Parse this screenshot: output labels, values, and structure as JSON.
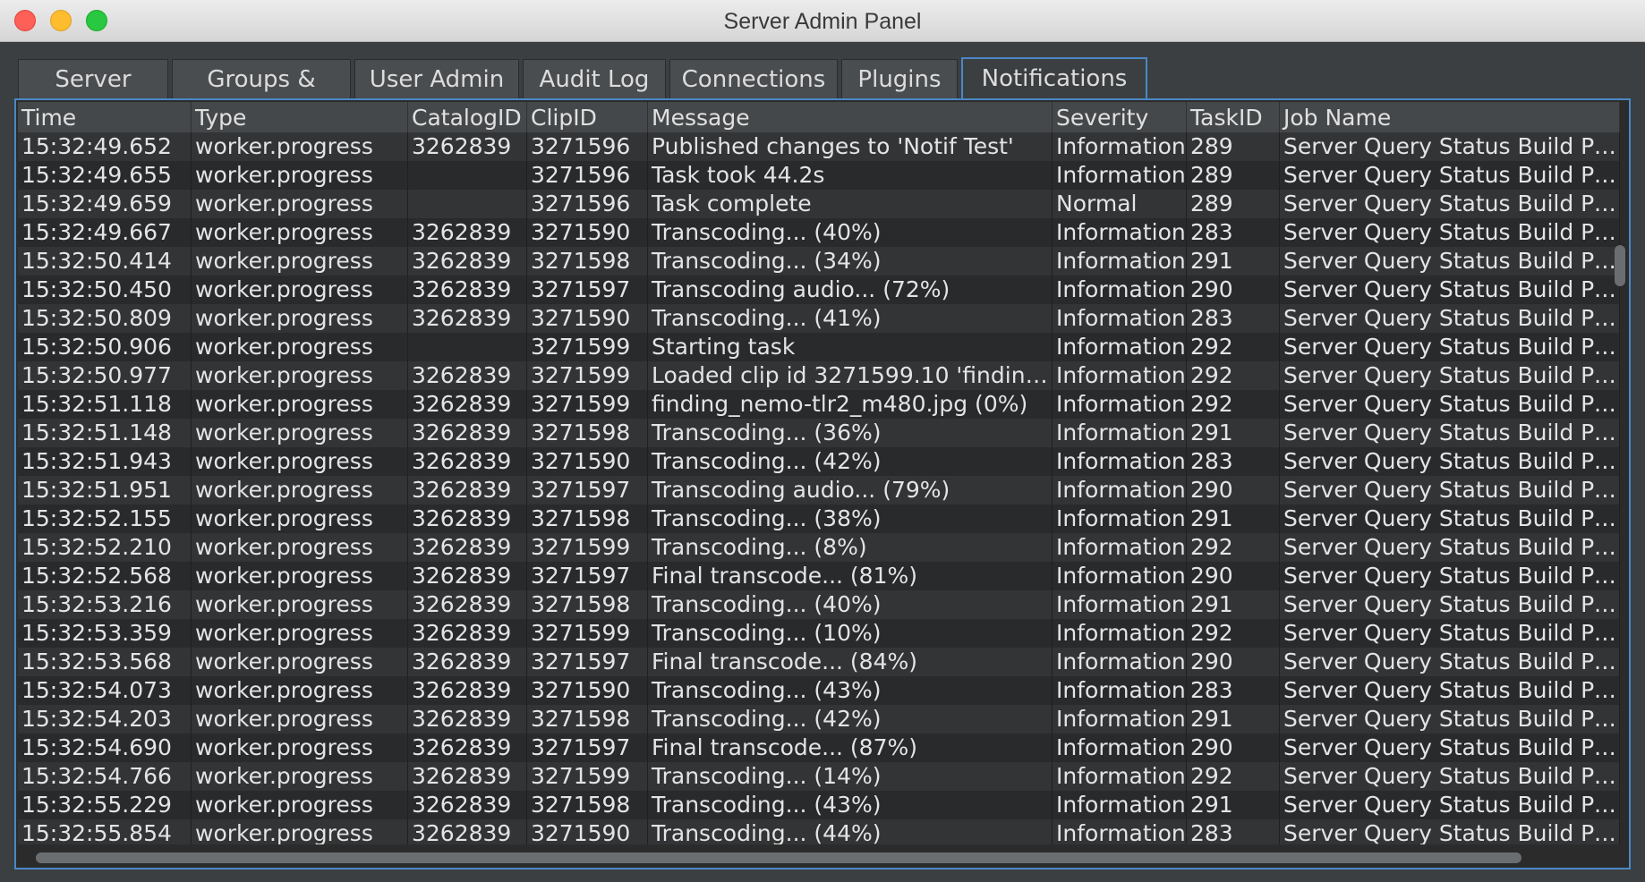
{
  "window": {
    "title": "Server Admin Panel"
  },
  "tabs": [
    {
      "label": "Server Status"
    },
    {
      "label": "Groups & Roles"
    },
    {
      "label": "User Admin"
    },
    {
      "label": "Audit Log"
    },
    {
      "label": "Connections"
    },
    {
      "label": "Plugins"
    },
    {
      "label": "Notifications"
    }
  ],
  "active_tab": "Notifications",
  "table": {
    "columns": [
      "Time",
      "Type",
      "CatalogID",
      "ClipID",
      "Message",
      "Severity",
      "TaskID",
      "Job Name"
    ],
    "rows": [
      [
        "15:32:49.652",
        "worker.progress",
        "3262839",
        "3271596",
        "Published changes to 'Notif Test'",
        "Information",
        "289",
        "Server Query Status Build Proxy"
      ],
      [
        "15:32:49.655",
        "worker.progress",
        "",
        "3271596",
        "Task took 44.2s",
        "Information",
        "289",
        "Server Query Status Build Proxy"
      ],
      [
        "15:32:49.659",
        "worker.progress",
        "",
        "3271596",
        "Task complete",
        "Normal",
        "289",
        "Server Query Status Build Proxy"
      ],
      [
        "15:32:49.667",
        "worker.progress",
        "3262839",
        "3271590",
        "Transcoding... (40%)",
        "Information",
        "283",
        "Server Query Status Build Proxy"
      ],
      [
        "15:32:50.414",
        "worker.progress",
        "3262839",
        "3271598",
        "Transcoding... (34%)",
        "Information",
        "291",
        "Server Query Status Build Proxy"
      ],
      [
        "15:32:50.450",
        "worker.progress",
        "3262839",
        "3271597",
        "Transcoding audio... (72%)",
        "Information",
        "290",
        "Server Query Status Build Proxy"
      ],
      [
        "15:32:50.809",
        "worker.progress",
        "3262839",
        "3271590",
        "Transcoding... (41%)",
        "Information",
        "283",
        "Server Query Status Build Proxy"
      ],
      [
        "15:32:50.906",
        "worker.progress",
        "",
        "3271599",
        "Starting task",
        "Information",
        "292",
        "Server Query Status Build Proxy"
      ],
      [
        "15:32:50.977",
        "worker.progress",
        "3262839",
        "3271599",
        "Loaded clip id 3271599.10 'finding...",
        "Information",
        "292",
        "Server Query Status Build Proxy"
      ],
      [
        "15:32:51.118",
        "worker.progress",
        "3262839",
        "3271599",
        "finding_nemo-tlr2_m480.jpg (0%)",
        "Information",
        "292",
        "Server Query Status Build Proxy"
      ],
      [
        "15:32:51.148",
        "worker.progress",
        "3262839",
        "3271598",
        "Transcoding... (36%)",
        "Information",
        "291",
        "Server Query Status Build Proxy"
      ],
      [
        "15:32:51.943",
        "worker.progress",
        "3262839",
        "3271590",
        "Transcoding... (42%)",
        "Information",
        "283",
        "Server Query Status Build Proxy"
      ],
      [
        "15:32:51.951",
        "worker.progress",
        "3262839",
        "3271597",
        "Transcoding audio... (79%)",
        "Information",
        "290",
        "Server Query Status Build Proxy"
      ],
      [
        "15:32:52.155",
        "worker.progress",
        "3262839",
        "3271598",
        "Transcoding... (38%)",
        "Information",
        "291",
        "Server Query Status Build Proxy"
      ],
      [
        "15:32:52.210",
        "worker.progress",
        "3262839",
        "3271599",
        "Transcoding... (8%)",
        "Information",
        "292",
        "Server Query Status Build Proxy"
      ],
      [
        "15:32:52.568",
        "worker.progress",
        "3262839",
        "3271597",
        "Final transcode... (81%)",
        "Information",
        "290",
        "Server Query Status Build Proxy"
      ],
      [
        "15:32:53.216",
        "worker.progress",
        "3262839",
        "3271598",
        "Transcoding... (40%)",
        "Information",
        "291",
        "Server Query Status Build Proxy"
      ],
      [
        "15:32:53.359",
        "worker.progress",
        "3262839",
        "3271599",
        "Transcoding... (10%)",
        "Information",
        "292",
        "Server Query Status Build Proxy"
      ],
      [
        "15:32:53.568",
        "worker.progress",
        "3262839",
        "3271597",
        "Final transcode... (84%)",
        "Information",
        "290",
        "Server Query Status Build Proxy"
      ],
      [
        "15:32:54.073",
        "worker.progress",
        "3262839",
        "3271590",
        "Transcoding... (43%)",
        "Information",
        "283",
        "Server Query Status Build Proxy"
      ],
      [
        "15:32:54.203",
        "worker.progress",
        "3262839",
        "3271598",
        "Transcoding... (42%)",
        "Information",
        "291",
        "Server Query Status Build Proxy"
      ],
      [
        "15:32:54.690",
        "worker.progress",
        "3262839",
        "3271597",
        "Final transcode... (87%)",
        "Information",
        "290",
        "Server Query Status Build Proxy"
      ],
      [
        "15:32:54.766",
        "worker.progress",
        "3262839",
        "3271599",
        "Transcoding... (14%)",
        "Information",
        "292",
        "Server Query Status Build Proxy"
      ],
      [
        "15:32:55.229",
        "worker.progress",
        "3262839",
        "3271598",
        "Transcoding... (43%)",
        "Information",
        "291",
        "Server Query Status Build Proxy"
      ],
      [
        "15:32:55.854",
        "worker.progress",
        "3262839",
        "3271590",
        "Transcoding... (44%)",
        "Information",
        "283",
        "Server Query Status Build Proxy"
      ]
    ]
  },
  "colors": {
    "accent": "#4a88c7",
    "background": "#3c3f41",
    "row_odd": "#323436",
    "row_even": "#282a2c"
  }
}
